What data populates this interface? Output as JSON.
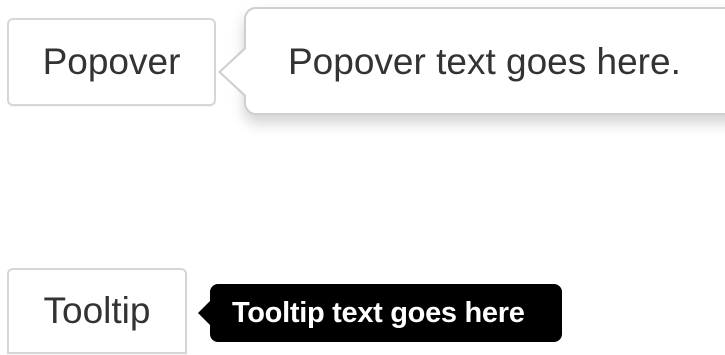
{
  "popover_demo": {
    "button_label": "Popover",
    "popover_text": "Popover text goes here."
  },
  "tooltip_demo": {
    "button_label": "Tooltip",
    "tooltip_text": "Tooltip text goes here"
  }
}
